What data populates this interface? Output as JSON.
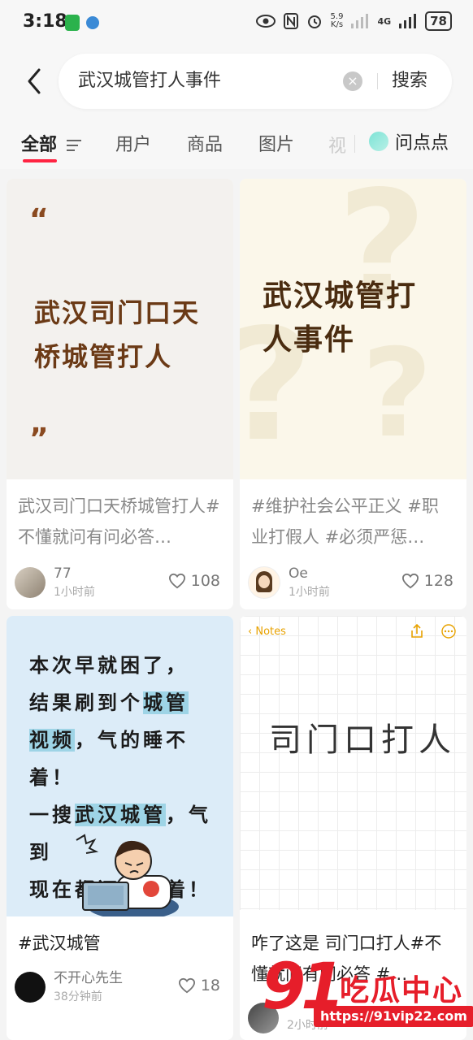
{
  "status_bar": {
    "time": "3:18",
    "net_speed": "5.9\nK/s",
    "network": "4G",
    "battery": "78"
  },
  "search": {
    "query": "武汉城管打人事件",
    "button_label": "搜索"
  },
  "tabs": {
    "items": [
      "全部",
      "用户",
      "商品",
      "图片"
    ],
    "faded": "视",
    "wenwen": "问点点"
  },
  "feed": [
    {
      "cover_text_line1": "武汉司门口天",
      "cover_text_line2": "桥城管打人",
      "quote_open": "“",
      "quote_close": "”",
      "title": "武汉司门口天桥城管打人#不懂就问有问必答…",
      "author": "77",
      "time": "1小时前",
      "likes": "108"
    },
    {
      "cover_text_line1": "武汉城管打",
      "cover_text_line2": "人事件",
      "title": "#维护社会公平正义 #职业打假人 #必须严惩…",
      "author": "Oe",
      "time": "1小时前",
      "likes": "128"
    },
    {
      "cover_lines": [
        "本次早就困了，",
        "结果刷到个",
        "城管",
        "视频",
        "，气的睡不着！",
        "一搜",
        "武汉城管",
        "，气到",
        "现在都还睡不着！"
      ],
      "title": "#武汉城管",
      "author": "不开心先生",
      "time": "38分钟前",
      "likes": "18"
    },
    {
      "notes_label": "Notes",
      "cover_text": "司门口打人",
      "title": "咋了这是 司门口打人#不懂就问有问必答 #…",
      "time": "2小时前"
    }
  ],
  "watermark": {
    "brand_num": "91",
    "brand_cn": "吃瓜中心",
    "url": "https://91vip22.com"
  },
  "colors": {
    "accent": "#ff2442",
    "watermark": "#e61e2a"
  }
}
